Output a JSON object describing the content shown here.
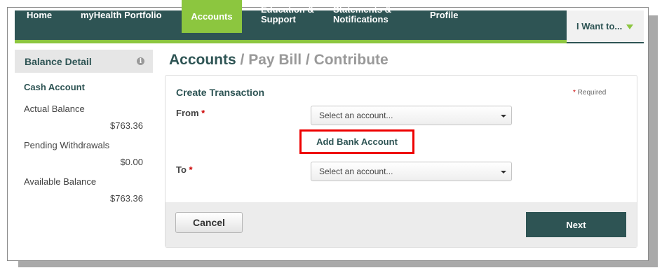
{
  "nav": {
    "items": [
      {
        "label": "Home"
      },
      {
        "label": "myHealth Portfolio"
      },
      {
        "label": "Accounts"
      },
      {
        "label_line1": "Education &",
        "label_line2": "Support"
      },
      {
        "label_line1": "Statements &",
        "label_line2": "Notifications"
      },
      {
        "label": "Profile"
      }
    ],
    "i_want": "I Want to..."
  },
  "sidebar": {
    "title": "Balance Detail",
    "info_icon": "i",
    "section": "Cash Account",
    "rows": [
      {
        "label": "Actual Balance",
        "value": "$763.36"
      },
      {
        "label": "Pending Withdrawals",
        "value": "$0.00"
      },
      {
        "label": "Available Balance",
        "value": "$763.36"
      }
    ]
  },
  "main": {
    "title": "Accounts",
    "title_sub": " / Pay Bill / Contribute",
    "form": {
      "title": "Create Transaction",
      "required_star": "*",
      "required_text": " Required",
      "from_label": "From",
      "to_label": "To",
      "star": " *",
      "from_select": "Select an account...",
      "to_select": "Select an account...",
      "add_bank": "Add Bank Account",
      "cancel": "Cancel",
      "next": "Next"
    }
  },
  "colors": {
    "nav_bg": "#2e5454",
    "accent": "#8cc63f",
    "highlight_box": "#ee0000"
  }
}
